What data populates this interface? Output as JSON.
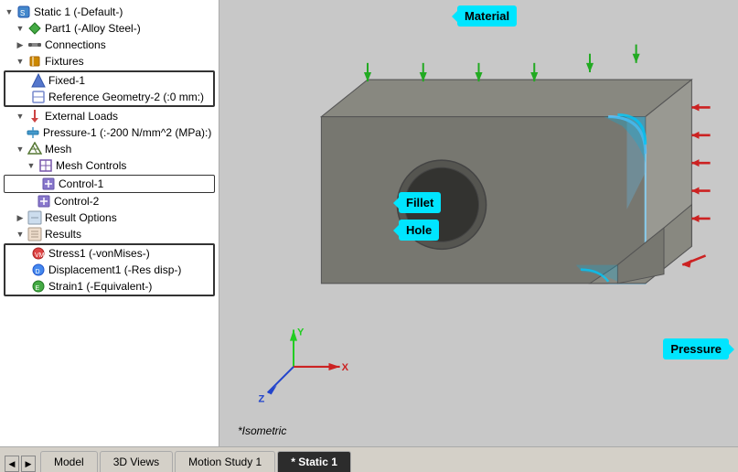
{
  "tree": {
    "root": "Static 1 (-Default-)",
    "part": "Part1 (-Alloy Steel-)",
    "connections": "Connections",
    "fixtures_group": "Fixtures",
    "fixtures": [
      {
        "label": "Fixed-1",
        "selected": true
      },
      {
        "label": "Reference Geometry-2 (:0 mm:)",
        "selected": true
      }
    ],
    "external_loads": "External Loads",
    "pressure": "Pressure-1 (:-200 N/mm^2 (MPa):)",
    "mesh": "Mesh",
    "mesh_controls": "Mesh Controls",
    "controls": [
      {
        "label": "Control-1",
        "selected": true
      },
      {
        "label": "Control-2"
      }
    ],
    "result_options": "Result Options",
    "results": "Results",
    "result_items": [
      {
        "label": "Stress1 (-vonMises-)"
      },
      {
        "label": "Displacement1 (-Res disp-)"
      },
      {
        "label": "Strain1 (-Equivalent-)"
      }
    ]
  },
  "callouts": {
    "material": "Material",
    "fillet": "Fillet",
    "hole": "Hole",
    "pressure": "Pressure"
  },
  "viewport": {
    "label": "*Isometric"
  },
  "tabs": [
    {
      "label": "Model",
      "active": false
    },
    {
      "label": "3D Views",
      "active": false
    },
    {
      "label": "Motion Study 1",
      "active": false
    },
    {
      "label": "* Static 1",
      "active": true
    }
  ]
}
